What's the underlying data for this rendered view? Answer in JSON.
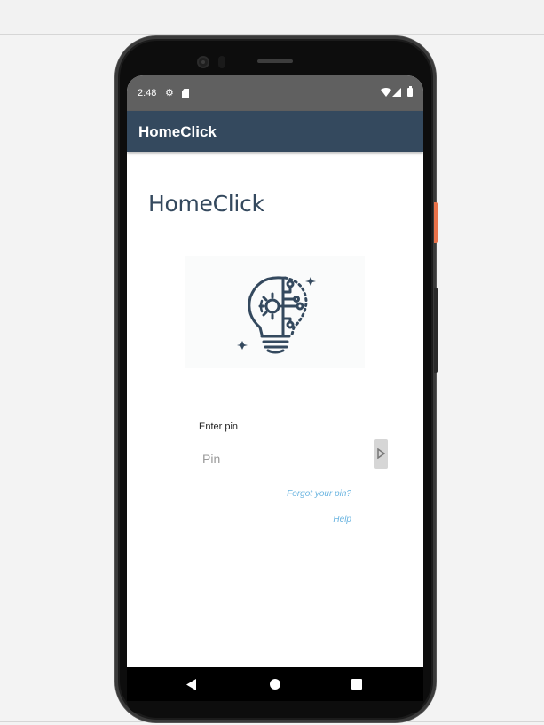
{
  "status_bar": {
    "time": "2:48"
  },
  "app_bar": {
    "title": "HomeClick"
  },
  "main": {
    "heading": "HomeClick",
    "logo_icon": "lightbulb-circuit-icon",
    "pin_label": "Enter pin",
    "pin_placeholder": "Pin",
    "pin_value": "",
    "forgot_link": "Forgot your pin?",
    "help_link": "Help"
  },
  "nav_bar": {
    "back_icon": "back-triangle-icon",
    "home_icon": "home-circle-icon",
    "recents_icon": "recents-square-icon"
  },
  "colors": {
    "app_bar": "#34495e",
    "heading": "#34495e",
    "link": "#6ab4e0",
    "status_bar": "#606060",
    "accent_orange": "#e8724a"
  }
}
